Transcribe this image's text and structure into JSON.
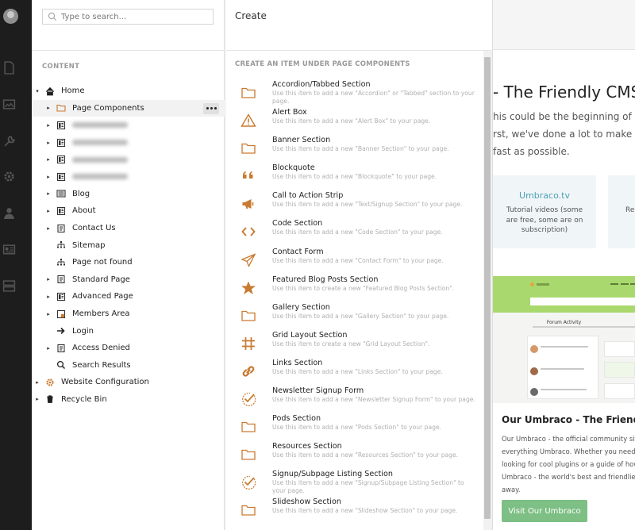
{
  "tree": {
    "search_placeholder": "Type to search...",
    "heading": "CONTENT",
    "items": [
      {
        "label": "Home",
        "level": 0,
        "caret": "▾",
        "icon": "home-icon"
      },
      {
        "label": "Page Components",
        "level": 1,
        "caret": "▸",
        "icon": "folder-icon",
        "selected": true
      },
      {
        "label": "",
        "level": 1,
        "caret": "▸",
        "icon": "document-icon",
        "blurred": true
      },
      {
        "label": "",
        "level": 1,
        "caret": "▸",
        "icon": "document-icon",
        "blurred": true
      },
      {
        "label": "",
        "level": 1,
        "caret": "▸",
        "icon": "document-icon",
        "blurred": true
      },
      {
        "label": "",
        "level": 1,
        "caret": "▸",
        "icon": "document-icon",
        "blurred": true
      },
      {
        "label": "Blog",
        "level": 1,
        "caret": "▸",
        "icon": "newspaper-icon"
      },
      {
        "label": "About",
        "level": 1,
        "caret": "▸",
        "icon": "document-icon"
      },
      {
        "label": "Contact Us",
        "level": 1,
        "caret": "▸",
        "icon": "notepad-icon"
      },
      {
        "label": "Sitemap",
        "level": 1,
        "caret": "",
        "icon": "sitemap-icon"
      },
      {
        "label": "Page not found",
        "level": 1,
        "caret": "",
        "icon": "sitemap-icon"
      },
      {
        "label": "Standard Page",
        "level": 1,
        "caret": "▸",
        "icon": "notepad-icon"
      },
      {
        "label": "Advanced Page",
        "level": 1,
        "caret": "▸",
        "icon": "document-icon"
      },
      {
        "label": "Members Area",
        "level": 1,
        "caret": "▸",
        "icon": "members-icon"
      },
      {
        "label": "Login",
        "level": 1,
        "caret": "",
        "icon": "arrow-right-icon"
      },
      {
        "label": "Access Denied",
        "level": 1,
        "caret": "▸",
        "icon": "notepad-icon"
      },
      {
        "label": "Search Results",
        "level": 1,
        "caret": "",
        "icon": "search-icon"
      },
      {
        "label": "Website Configuration",
        "level": 0,
        "caret": "▸",
        "icon": "cog-icon"
      },
      {
        "label": "Recycle Bin",
        "level": 0,
        "caret": "▸",
        "icon": "trash-icon"
      }
    ]
  },
  "create": {
    "title": "Create",
    "heading": "CREATE AN ITEM UNDER PAGE COMPONENTS",
    "items": [
      {
        "name": "Accordion/Tabbed Section",
        "desc": "Use this item to add a new \"Accordion\" or \"Tabbed\" section to your page.",
        "icon": "folder-icon"
      },
      {
        "name": "Alert Box",
        "desc": "Use this item to add a new \"Alert Box\" to your page.",
        "icon": "alert-icon"
      },
      {
        "name": "Banner Section",
        "desc": "Use this item to add a new \"Banner Section\" to your page.",
        "icon": "folder-icon"
      },
      {
        "name": "Blockquote",
        "desc": "Use this item to add a new \"Blockquote\" to your page.",
        "icon": "quote-icon"
      },
      {
        "name": "Call to Action Strip",
        "desc": "Use this item to add a new \"Text/Signup Section\" to your page.",
        "icon": "megaphone-icon"
      },
      {
        "name": "Code Section",
        "desc": "Use this item to add a new \"Code Section\" to your page.",
        "icon": "code-icon"
      },
      {
        "name": "Contact Form",
        "desc": "Use this item to add a new \"Contact Form\" to your page.",
        "icon": "paper-plane-icon"
      },
      {
        "name": "Featured Blog Posts Section",
        "desc": "Use this item to create a new \"Featured Blog Posts Section\".",
        "icon": "star-icon"
      },
      {
        "name": "Gallery Section",
        "desc": "Use this item to add a new \"Gallery Section\" to your page.",
        "icon": "folder-icon"
      },
      {
        "name": "Grid Layout Section",
        "desc": "Use this item to create a new \"Grid Layout Section\".",
        "icon": "grid-icon"
      },
      {
        "name": "Links Section",
        "desc": "Use this item to add a new \"Links Section\" to your page.",
        "icon": "link-icon"
      },
      {
        "name": "Newsletter Signup Form",
        "desc": "Use this item to add a new \"Newsletter Signup Form\" to your page.",
        "icon": "checkmark-icon"
      },
      {
        "name": "Pods Section",
        "desc": "Use this item to add a new \"Pods Section\" to your page.",
        "icon": "folder-icon"
      },
      {
        "name": "Resources Section",
        "desc": "Use this item to add a new \"Resources Section\" to your page.",
        "icon": "folder-icon"
      },
      {
        "name": "Signup/Subpage Listing Section",
        "desc": "Use this item to add a new \"Signup/Subpage Listing Section\" to your page.",
        "icon": "checkmark-icon"
      },
      {
        "name": "Slideshow Section",
        "desc": "Use this item to add a new \"Slideshow Section\" to your page.",
        "icon": "folder-icon"
      }
    ]
  },
  "dashboard": {
    "heading": "- The Friendly CMS",
    "intro_lines": [
      "his could be the beginning of sor",
      "rst, we've done a lot to make the",
      "fast as possible."
    ],
    "card1_title": "Umbraco.tv",
    "card1_desc": "Tutorial videos (some are free, some are on subscription)",
    "card2_desc": "Re",
    "shot_title": "Forum Activity",
    "promo_title": "Our Umbraco - The Friendlies",
    "promo_desc": "Our Umbraco - the official community site everything Umbraco. Whether you need a looking for cool plugins or a guide of how Umbraco - the world's best and friendliest click away.",
    "promo_button": "Visit Our Umbraco"
  },
  "colors": {
    "accent": "#c97a30",
    "rail": "#1d1d1d",
    "button_green": "#7dbf84",
    "link_blue": "#4d9fb8"
  }
}
